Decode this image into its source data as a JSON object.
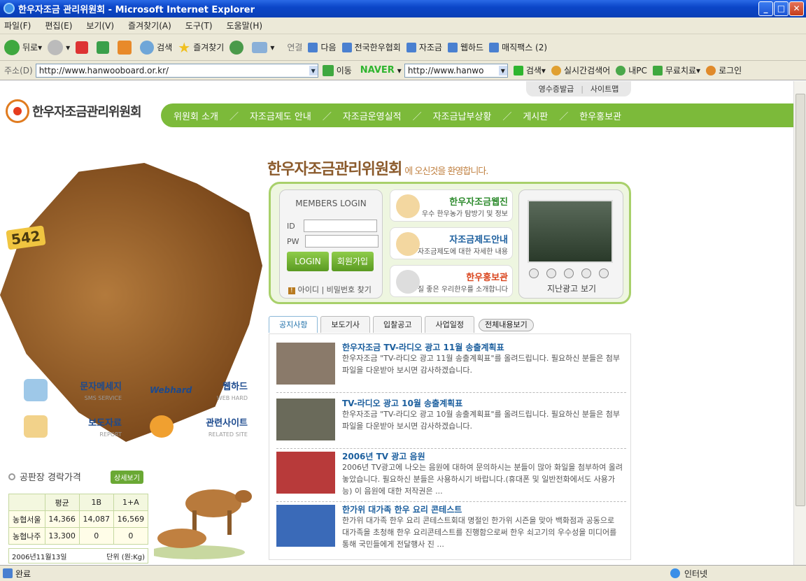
{
  "window": {
    "title": "한우자조금 관리위원회 - Microsoft Internet Explorer",
    "min": "_",
    "max": "□",
    "close": "✕"
  },
  "menu": [
    "파일(F)",
    "편집(E)",
    "보기(V)",
    "즐겨찾기(A)",
    "도구(T)",
    "도움말(H)"
  ],
  "toolbar": {
    "back": "뒤로",
    "search": "검색",
    "favorites": "즐겨찾기",
    "links_label": "연결",
    "links": [
      "다음",
      "전국한우협회",
      "자조금",
      "웹하드",
      "매직팩스 (2)"
    ]
  },
  "address": {
    "label": "주소(D)",
    "url": "http://www.hanwooboard.or.kr/",
    "go": "이동",
    "naver": "NAVER",
    "naver_url": "http://www.hanwo",
    "naver_search": "검색",
    "realtime": "실시간검색어",
    "mypc": "내PC",
    "free": "무료치료",
    "login": "로그인"
  },
  "status": {
    "left": "완료",
    "zone": "인터넷"
  },
  "site": {
    "top_links": [
      "영수증발급",
      "사이트맵"
    ],
    "logo": "한우자조금관리위원회",
    "nav": [
      "위원회 소개",
      "자조금제도 안내",
      "자조금운영실적",
      "자조금납부상황",
      "게시판",
      "한우홍보관"
    ],
    "ear_tag": "542",
    "welcome_main": "한우자조금관리위원회",
    "welcome_sub": "에 오신것을 환영합니다.",
    "login": {
      "title": "MEMBERS LOGIN",
      "id": "ID",
      "pw": "PW",
      "login_btn": "LOGIN",
      "join_btn": "회원가입",
      "find": "아이디 | 비밀번호 찾기"
    },
    "promos": [
      {
        "title": "한우자조금웹진",
        "desc": "우수 한우농가 탐방기 및 정보",
        "color": "#2e8b2e"
      },
      {
        "title": "자조금제도안내",
        "desc": "자조금제도에 대한 자세한 내용",
        "color": "#1c5f9e"
      },
      {
        "title": "한우홍보관",
        "desc": "질 좋은 우리한우를 소개합니다",
        "color": "#d9421a"
      }
    ],
    "tv_label": "지난광고 보기",
    "tabs": [
      "공지사항",
      "보도기사",
      "입찰공고",
      "사업일정"
    ],
    "all_btn": "전체내용보기",
    "news": [
      {
        "title": "한우자조금 TV-라디오 광고 11월 송출계획표",
        "body": "한우자조금 \"TV-라디오 광고 11월 송출계획표\"를 올려드립니다. 필요하신 분들은 첨부파일을 다운받아 보시면 감사하겠습니다."
      },
      {
        "title": "TV-라디오 광고 10월 송출계획표",
        "body": "한우자조금 \"TV-라디오 광고 10월 송출계획표\"를 올려드립니다. 필요하신 분들은 첨부파일을 다운받아 보시면 감사하겠습니다."
      },
      {
        "title": "2006년 TV 광고 음원",
        "body": "2006년 TV광고에 나오는 음원에 대하여 문의하시는 분들이 많아 화일을 첨부하여 올려 놓았습니다. 필요하신 분들은 사용하시기 바랍니다.(휴대폰 및 일반전화에서도 사용가능) 이 음원에 대한 저작권은 ..."
      },
      {
        "title": "한가위 대가족 한우 요리 콘테스트",
        "body": "한가위 대가족 한우 요리 콘테스트회대 명절인 한가위 시즌을 맞아 백화점과 공동으로 대가족을 초청해 한우 요리콘테스트를 진행함으로써 한우 쇠고기의 우수성을 미디어를 통해 국민들에게 전달행사 진 ..."
      }
    ],
    "quick": [
      {
        "title": "문자메세지",
        "sub": "SMS SERVICE",
        "color": "#9ec8e8"
      },
      {
        "title": "웹하드",
        "sub": "WEB HARD",
        "logo": "Webhard",
        "color": "#ffffff"
      },
      {
        "title": "보도자료",
        "sub": "REPORT",
        "color": "#f2d28a"
      },
      {
        "title": "관련사이트",
        "sub": "RELATED SITE",
        "color": "#f0a030"
      }
    ],
    "price": {
      "title": "공판장 경락가격",
      "more": "상세보기",
      "headers": [
        "",
        "평균",
        "1B",
        "1+A"
      ],
      "rows": [
        [
          "농협서울",
          "14,366",
          "14,087",
          "16,569"
        ],
        [
          "농협나주",
          "13,300",
          "0",
          "0"
        ]
      ],
      "date": "2006년11월13일",
      "unit": "단위 (원:Kg)"
    }
  }
}
